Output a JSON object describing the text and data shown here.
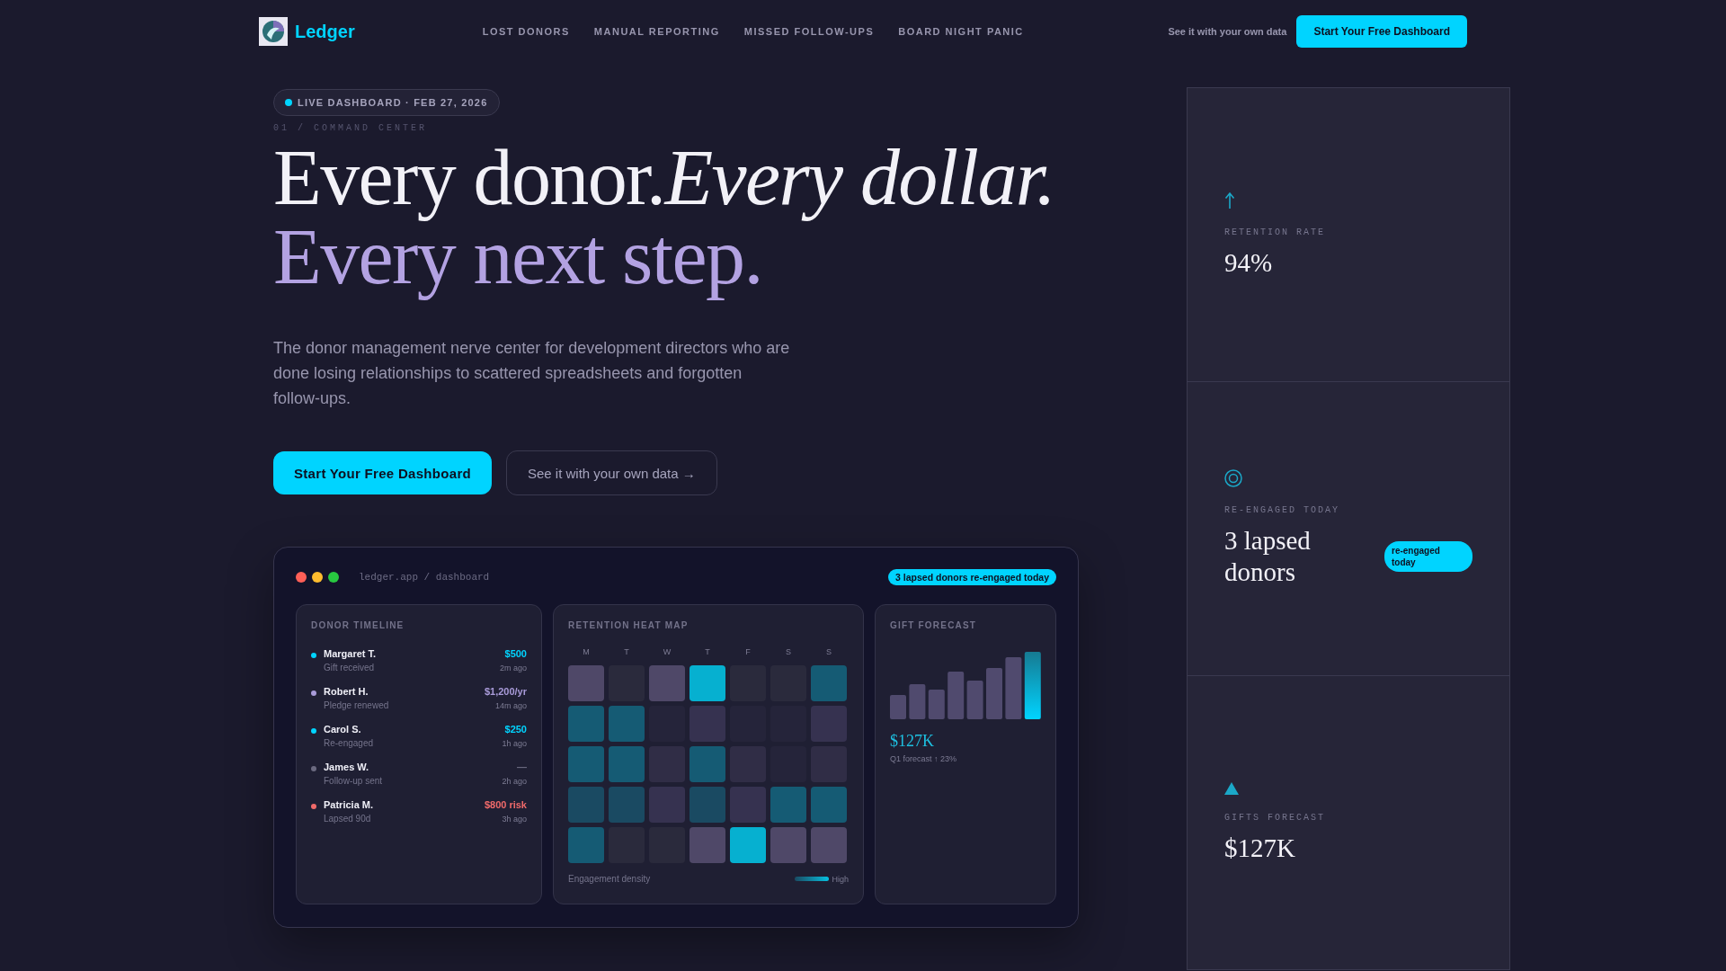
{
  "nav": {
    "brand": "Ledger",
    "links": [
      "LOST DONORS",
      "MANUAL REPORTING",
      "MISSED FOLLOW-UPS",
      "BOARD NIGHT PANIC"
    ],
    "secondary_link": "See it with your own data",
    "cta": "Start Your Free Dashboard"
  },
  "hero": {
    "badge": "LIVE DASHBOARD · FEB 27, 2026",
    "eyebrow": "01 / COMMAND CENTER",
    "headline_line_1": "Every donor.*Every dollar.*",
    "headline_line_2": "Every next step.",
    "description": "The donor management nerve center for development directors who are done losing relationships to scattered spreadsheets and forgotten follow-ups.",
    "primary_button": "Start Your Free Dashboard",
    "secondary_button": "See it with your own data →"
  },
  "dashboard": {
    "url": "ledger.app / dashboard",
    "alert": "3 lapsed donors re-engaged today",
    "timeline": {
      "title": "DONOR TIMELINE",
      "items": [
        {
          "name": "Margaret T.",
          "action": "Gift received",
          "amount": "$500",
          "time": "2m ago",
          "color": "#00d4ff"
        },
        {
          "name": "Robert H.",
          "action": "Pledge renewed",
          "amount": "$1,200/yr",
          "time": "14m ago",
          "color": "#a99bd9"
        },
        {
          "name": "Carol S.",
          "action": "Re-engaged",
          "amount": "$250",
          "time": "1h ago",
          "color": "#00d4ff"
        },
        {
          "name": "James W.",
          "action": "Follow-up sent",
          "amount": "—",
          "time": "2h ago",
          "color": "#6b6a80"
        },
        {
          "name": "Patricia M.",
          "action": "Lapsed 90d",
          "amount": "$800 risk",
          "time": "3h ago",
          "color": "#f06a6a"
        }
      ]
    },
    "heatmap": {
      "title": "RETENTION HEAT MAP",
      "days": [
        "M",
        "T",
        "W",
        "T",
        "F",
        "S",
        "S"
      ],
      "legend_label": "Engagement density",
      "legend_high": "High"
    },
    "forecast": {
      "title": "GIFT FORECAST",
      "value": "$127K",
      "note": "Q1 forecast ↑ 23%"
    }
  },
  "stats": [
    {
      "kind": "arrow",
      "label": "RETENTION RATE",
      "value": "94%"
    },
    {
      "kind": "target",
      "label": "RE-ENGAGED TODAY",
      "value": "3 lapsed donors",
      "badge": "re-engaged today"
    },
    {
      "kind": "triangle",
      "label": "GIFTS FORECAST",
      "value": "$127K"
    }
  ]
}
